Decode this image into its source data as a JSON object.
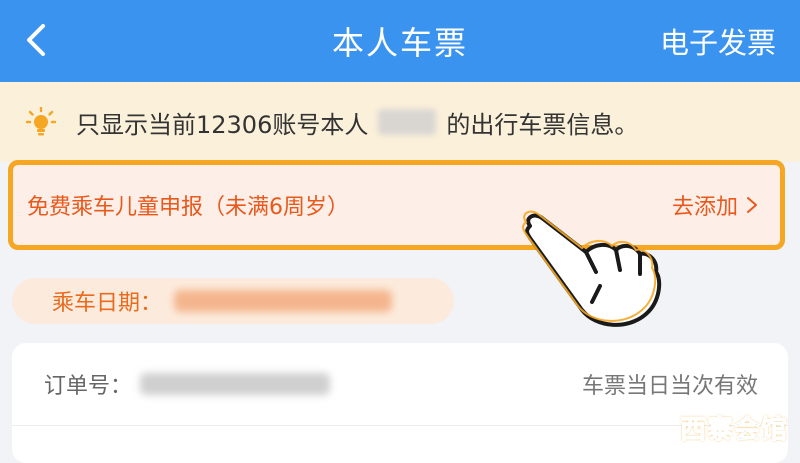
{
  "header": {
    "back_icon": "chevron-left-icon",
    "title": "本人车票",
    "action_label": "电子发票",
    "background_color": "#3b93f0"
  },
  "notice": {
    "icon": "lightbulb-icon",
    "text_before": "只显示当前12306账号本人",
    "text_after": "的出行车票信息。"
  },
  "child_banner": {
    "label": "免费乘车儿童申报（未满6周岁）",
    "action_label": "去添加",
    "action_icon": "chevron-right-icon",
    "highlight_color": "#f5a623"
  },
  "ride_date": {
    "label": "乘车日期："
  },
  "order": {
    "label": "订单号：",
    "status": "车票当日当次有效"
  },
  "watermark": {
    "part1": "西寨",
    "part2": "会馆"
  }
}
